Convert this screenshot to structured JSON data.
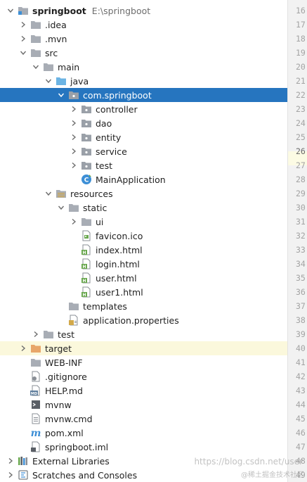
{
  "project": {
    "name": "springboot",
    "path": "E:\\springboot"
  },
  "tree": [
    {
      "id": "springboot",
      "label": "springboot",
      "path": "E:\\springboot",
      "icon": "project-folder-icon",
      "arrow": "down"
    },
    {
      "id": "idea",
      "label": ".idea",
      "icon": "folder-icon",
      "arrow": "right"
    },
    {
      "id": "mvn",
      "label": ".mvn",
      "icon": "folder-icon",
      "arrow": "right"
    },
    {
      "id": "src",
      "label": "src",
      "icon": "folder-icon",
      "arrow": "down"
    },
    {
      "id": "main",
      "label": "main",
      "icon": "folder-icon",
      "arrow": "down"
    },
    {
      "id": "java",
      "label": "java",
      "icon": "source-folder-icon",
      "arrow": "down"
    },
    {
      "id": "com-springboot",
      "label": "com.springboot",
      "icon": "package-icon",
      "arrow": "down",
      "selected": true
    },
    {
      "id": "controller",
      "label": "controller",
      "icon": "package-icon",
      "arrow": "right"
    },
    {
      "id": "dao",
      "label": "dao",
      "icon": "package-icon",
      "arrow": "right"
    },
    {
      "id": "entity",
      "label": "entity",
      "icon": "package-icon",
      "arrow": "right"
    },
    {
      "id": "service",
      "label": "service",
      "icon": "package-icon",
      "arrow": "right"
    },
    {
      "id": "test-pkg",
      "label": "test",
      "icon": "package-icon",
      "arrow": "right"
    },
    {
      "id": "mainapplication",
      "label": "MainApplication",
      "icon": "java-class-icon",
      "arrow": "none"
    },
    {
      "id": "resources",
      "label": "resources",
      "icon": "resources-folder-icon",
      "arrow": "down"
    },
    {
      "id": "static",
      "label": "static",
      "icon": "folder-icon",
      "arrow": "down"
    },
    {
      "id": "ui",
      "label": "ui",
      "icon": "folder-icon",
      "arrow": "right"
    },
    {
      "id": "favicon",
      "label": "favicon.ico",
      "icon": "image-file-icon",
      "arrow": "none"
    },
    {
      "id": "index-html",
      "label": "index.html",
      "icon": "html-file-icon",
      "arrow": "none"
    },
    {
      "id": "login-html",
      "label": "login.html",
      "icon": "html-file-icon",
      "arrow": "none"
    },
    {
      "id": "user-html",
      "label": "user.html",
      "icon": "html-file-icon",
      "arrow": "none"
    },
    {
      "id": "user1-html",
      "label": "user1.html",
      "icon": "html-file-icon",
      "arrow": "none"
    },
    {
      "id": "templates",
      "label": "templates",
      "icon": "folder-icon",
      "arrow": "none"
    },
    {
      "id": "app-properties",
      "label": "application.properties",
      "icon": "properties-file-icon",
      "arrow": "none"
    },
    {
      "id": "test",
      "label": "test",
      "icon": "folder-icon",
      "arrow": "right"
    },
    {
      "id": "target",
      "label": "target",
      "icon": "excluded-folder-icon",
      "arrow": "right",
      "highlight": true
    },
    {
      "id": "web-inf",
      "label": "WEB-INF",
      "icon": "folder-icon",
      "arrow": "none"
    },
    {
      "id": "gitignore",
      "label": ".gitignore",
      "icon": "gitignore-file-icon",
      "arrow": "none"
    },
    {
      "id": "help-md",
      "label": "HELP.md",
      "icon": "markdown-file-icon",
      "arrow": "none"
    },
    {
      "id": "mvnw",
      "label": "mvnw",
      "icon": "script-file-icon",
      "arrow": "none"
    },
    {
      "id": "mvnw-cmd",
      "label": "mvnw.cmd",
      "icon": "text-file-icon",
      "arrow": "none"
    },
    {
      "id": "pom-xml",
      "label": "pom.xml",
      "icon": "maven-icon",
      "arrow": "none"
    },
    {
      "id": "springboot-iml",
      "label": "springboot.iml",
      "icon": "iml-file-icon",
      "arrow": "none"
    },
    {
      "id": "external-libraries",
      "label": "External Libraries",
      "icon": "libraries-icon",
      "arrow": "right"
    },
    {
      "id": "scratches",
      "label": "Scratches and Consoles",
      "icon": "scratches-icon",
      "arrow": "right"
    }
  ],
  "gutter": {
    "line_numbers": [
      "16",
      "17",
      "18",
      "19",
      "20",
      "21",
      "22",
      "23",
      "24",
      "25",
      "26",
      "27",
      "28",
      "29",
      "30",
      "31",
      "32",
      "33",
      "34",
      "35",
      "36",
      "37",
      "38",
      "39",
      "40",
      "41",
      "42",
      "43",
      "44",
      "45",
      "46",
      "47",
      "48",
      "49"
    ],
    "current_line": "26"
  },
  "watermark": "https://blog.csdn.net/user",
  "watermark2": "@稀土掘金技术社区",
  "colors": {
    "selection": "#2675bf",
    "highlight_row": "#fbf8dc",
    "folder": "#a8adb5",
    "package": "#9aa0a8",
    "source_folder": "#6cb4e4",
    "excluded_folder": "#e8a66a",
    "html_green": "#6aa84f",
    "class_blue": "#3d8fd6"
  }
}
